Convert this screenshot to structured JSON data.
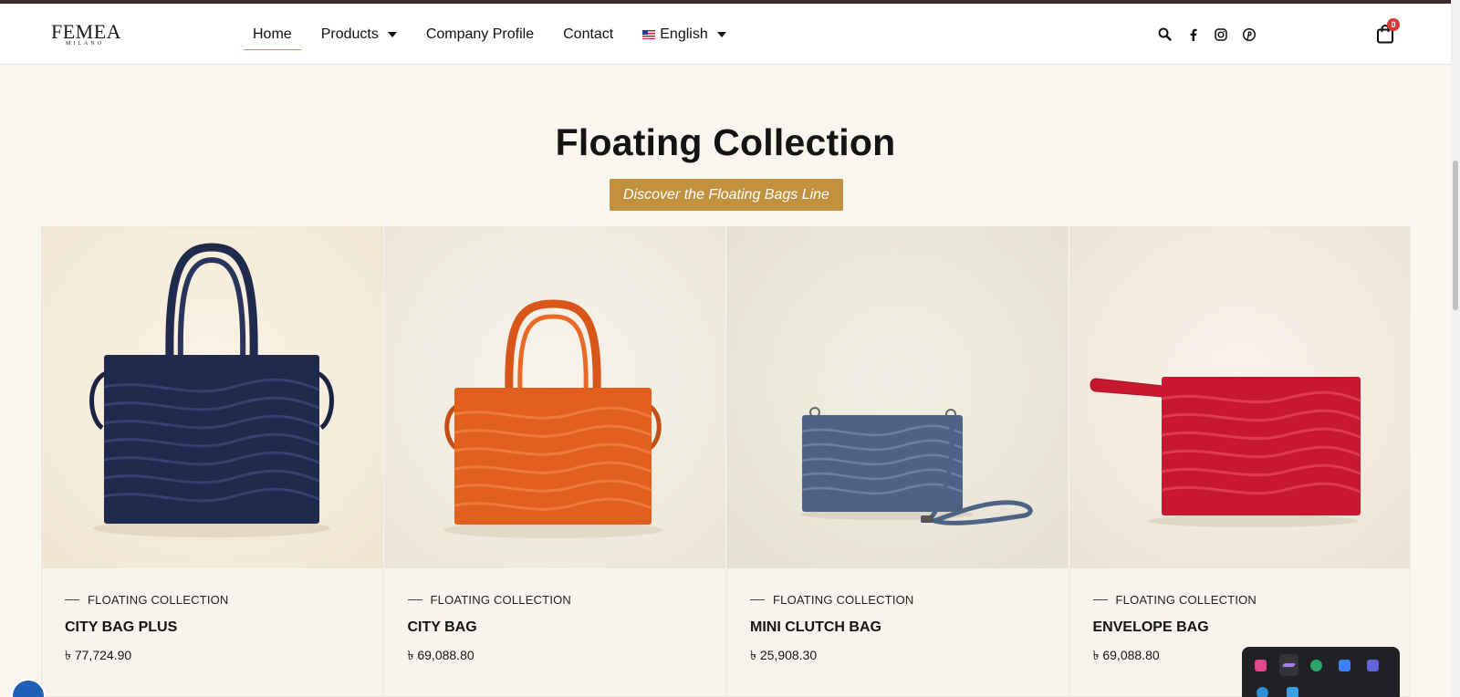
{
  "brand": {
    "logo_main": "FEMEA",
    "logo_sub": "MILANO"
  },
  "nav": {
    "items": [
      {
        "label": "Home",
        "active": true
      },
      {
        "label": "Products",
        "dropdown": true
      },
      {
        "label": "Company Profile"
      },
      {
        "label": "Contact"
      }
    ],
    "language": "English"
  },
  "header_icons": [
    "search-icon",
    "facebook-icon",
    "instagram-icon",
    "pinterest-icon"
  ],
  "cart": {
    "count": "0"
  },
  "hero": {
    "title": "Floating Collection",
    "button": "Discover the Floating Bags Line"
  },
  "products": [
    {
      "category": "FLOATING COLLECTION",
      "name": "CITY BAG PLUS",
      "price": "৳ 77,724.90",
      "color": "#1f2a4d"
    },
    {
      "category": "FLOATING COLLECTION",
      "name": "CITY BAG",
      "price": "৳ 69,088.80",
      "color": "#e2601f"
    },
    {
      "category": "FLOATING COLLECTION",
      "name": "MINI CLUTCH BAG",
      "price": "৳ 25,908.30",
      "color": "#4d6383"
    },
    {
      "category": "FLOATING COLLECTION",
      "name": "ENVELOPE BAG",
      "price": "৳ 69,088.80",
      "color": "#c8182f"
    }
  ],
  "colors": {
    "accent": "#c2913f",
    "background": "#f9f5ef",
    "badge": "#d63a3a"
  },
  "tray_icons": [
    "photos-icon",
    "pen-icon",
    "edge-icon",
    "settings-icon",
    "teams-icon",
    "app-icon",
    "store-icon"
  ]
}
